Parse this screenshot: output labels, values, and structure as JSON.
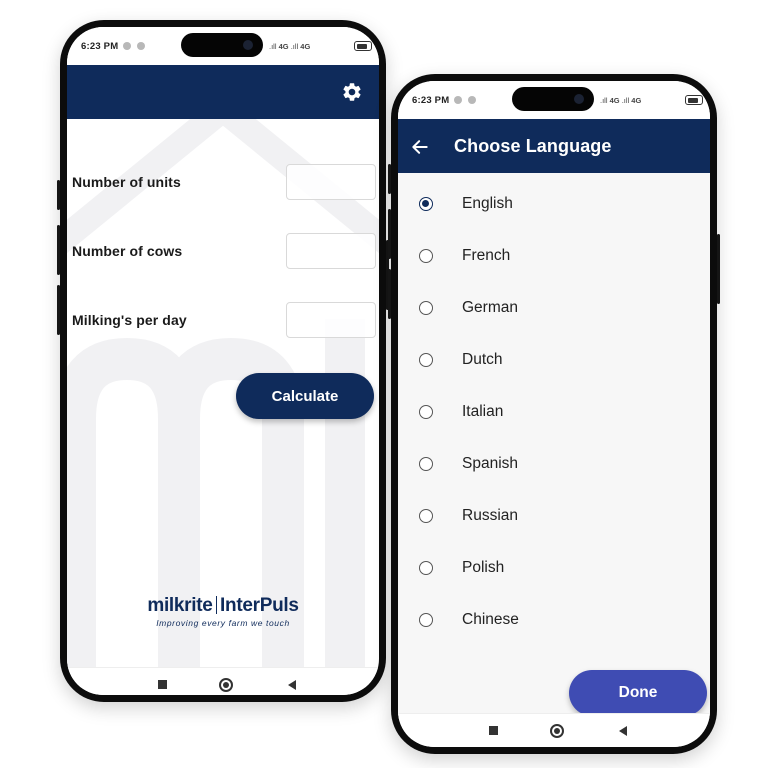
{
  "colors": {
    "brand_navy": "#0f2b5b",
    "done_button": "#3f4cb3",
    "list_background": "#f7f7f7"
  },
  "phone1": {
    "status_bar": {
      "time": "6:23 PM",
      "network_left": "4G",
      "network_right": "4G"
    },
    "app_bar": {
      "settings_icon": "gear-icon"
    },
    "form": {
      "fields": [
        {
          "label": "Number of units",
          "value": "",
          "placeholder": ""
        },
        {
          "label": "Number of cows",
          "value": "",
          "placeholder": ""
        },
        {
          "label": "Milking's per day",
          "value": "",
          "placeholder": ""
        }
      ],
      "calculate_label": "Calculate"
    },
    "brand": {
      "name_left": "milkrite",
      "name_right": "InterPuls",
      "tagline": "Improving every farm we touch"
    },
    "nav_bar": {
      "recents_icon": "square-icon",
      "home_icon": "circle-icon",
      "back_icon": "triangle-back-icon"
    }
  },
  "phone2": {
    "status_bar": {
      "time": "6:23 PM",
      "network_left": "4G",
      "network_right": "4G"
    },
    "app_bar": {
      "title": "Choose Language",
      "back_icon": "arrow-left-icon"
    },
    "languages": [
      {
        "label": "English",
        "selected": true
      },
      {
        "label": "French",
        "selected": false
      },
      {
        "label": "German",
        "selected": false
      },
      {
        "label": "Dutch",
        "selected": false
      },
      {
        "label": "Italian",
        "selected": false
      },
      {
        "label": "Spanish",
        "selected": false
      },
      {
        "label": "Russian",
        "selected": false
      },
      {
        "label": "Polish",
        "selected": false
      },
      {
        "label": "Chinese",
        "selected": false
      }
    ],
    "done_label": "Done",
    "nav_bar": {
      "recents_icon": "square-icon",
      "home_icon": "circle-icon",
      "back_icon": "triangle-back-icon"
    }
  }
}
